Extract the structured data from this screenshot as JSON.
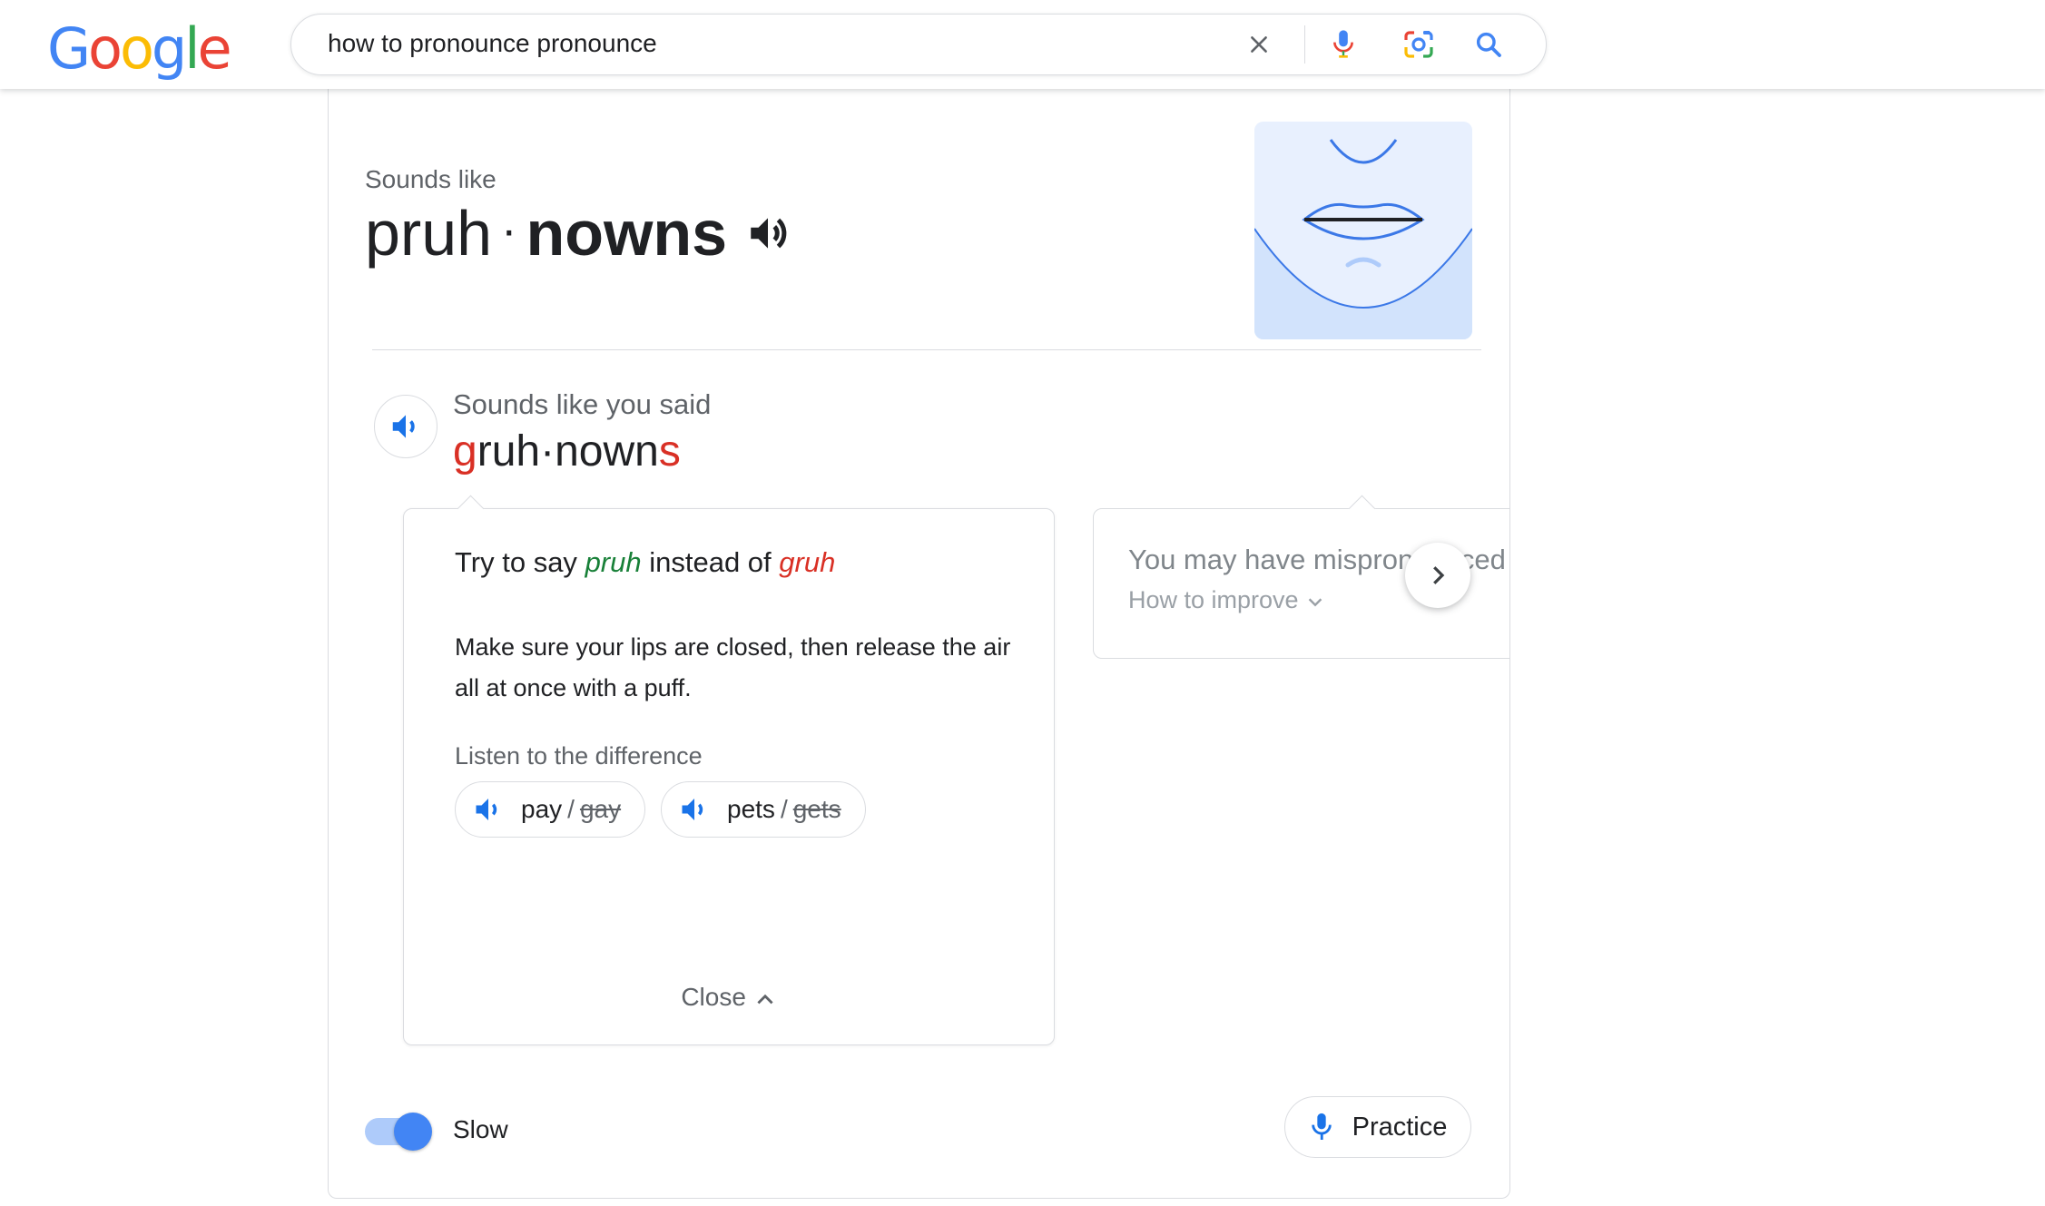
{
  "header": {
    "logo_letters": [
      "G",
      "o",
      "o",
      "g",
      "l",
      "e"
    ],
    "search_query": "how to pronounce pronounce",
    "icons": [
      "clear-icon",
      "mic-icon",
      "lens-icon",
      "search-icon"
    ]
  },
  "pronunciation": {
    "sounds_like_label": "Sounds like",
    "syllable_1": "pruh",
    "separator": "·",
    "syllable_2": "nowns",
    "speaker_icon": "volume-icon"
  },
  "you_said": {
    "label": "Sounds like you said",
    "part_1_error": "g",
    "part_1_rest": "ruh",
    "separator": "·",
    "part_2": "nown",
    "part_2_error": "s"
  },
  "tip": {
    "title_prefix": "Try to say",
    "good_sound": "pruh",
    "title_middle": "instead of",
    "bad_sound": "gruh",
    "body": "Make sure your lips are closed, then release the air all at once with a puff.",
    "listen_label": "Listen to the difference",
    "chips": [
      {
        "good": "pay",
        "sep": "/",
        "bad": "gay"
      },
      {
        "good": "pets",
        "sep": "/",
        "bad": "gets"
      }
    ],
    "close_label": "Close"
  },
  "tip2": {
    "title": "You may have mispronounced",
    "sub": "How to improve"
  },
  "footer": {
    "slow_label": "Slow",
    "slow_on": true,
    "practice_label": "Practice"
  },
  "colors": {
    "accent": "#1a73e8",
    "good": "#188038",
    "bad": "#d93025"
  }
}
